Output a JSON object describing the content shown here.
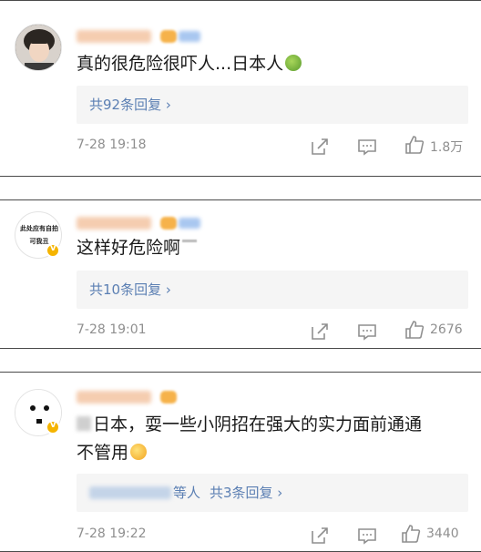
{
  "comments": [
    {
      "text": "真的很危险很吓人...日本人",
      "reply_link": "共92条回复 ›",
      "timestamp": "7-28 19:18",
      "like_count": "1.8万",
      "avatar_text": []
    },
    {
      "text": "这样好危险啊",
      "reply_link": "共10条回复 ›",
      "timestamp": "7-28 19:01",
      "like_count": "2676",
      "avatar_text": [
        "此处应有自拍",
        "可我丑"
      ]
    },
    {
      "text_line1": "日本，耍一些小阴招在强大的实力面前通通",
      "text_line2": "不管用",
      "reply_prefix": "等人",
      "reply_link": "共3条回复 ›",
      "timestamp": "7-28 19:22",
      "like_count": "3440"
    }
  ],
  "icons": {
    "share": "share-icon",
    "comment": "comment-icon",
    "like": "thumbs-up-icon"
  },
  "colors": {
    "link": "#5b7fb3",
    "meta": "#8f8f8f",
    "divider": "#4a4a4a",
    "reply_bg": "#f5f5f5"
  }
}
